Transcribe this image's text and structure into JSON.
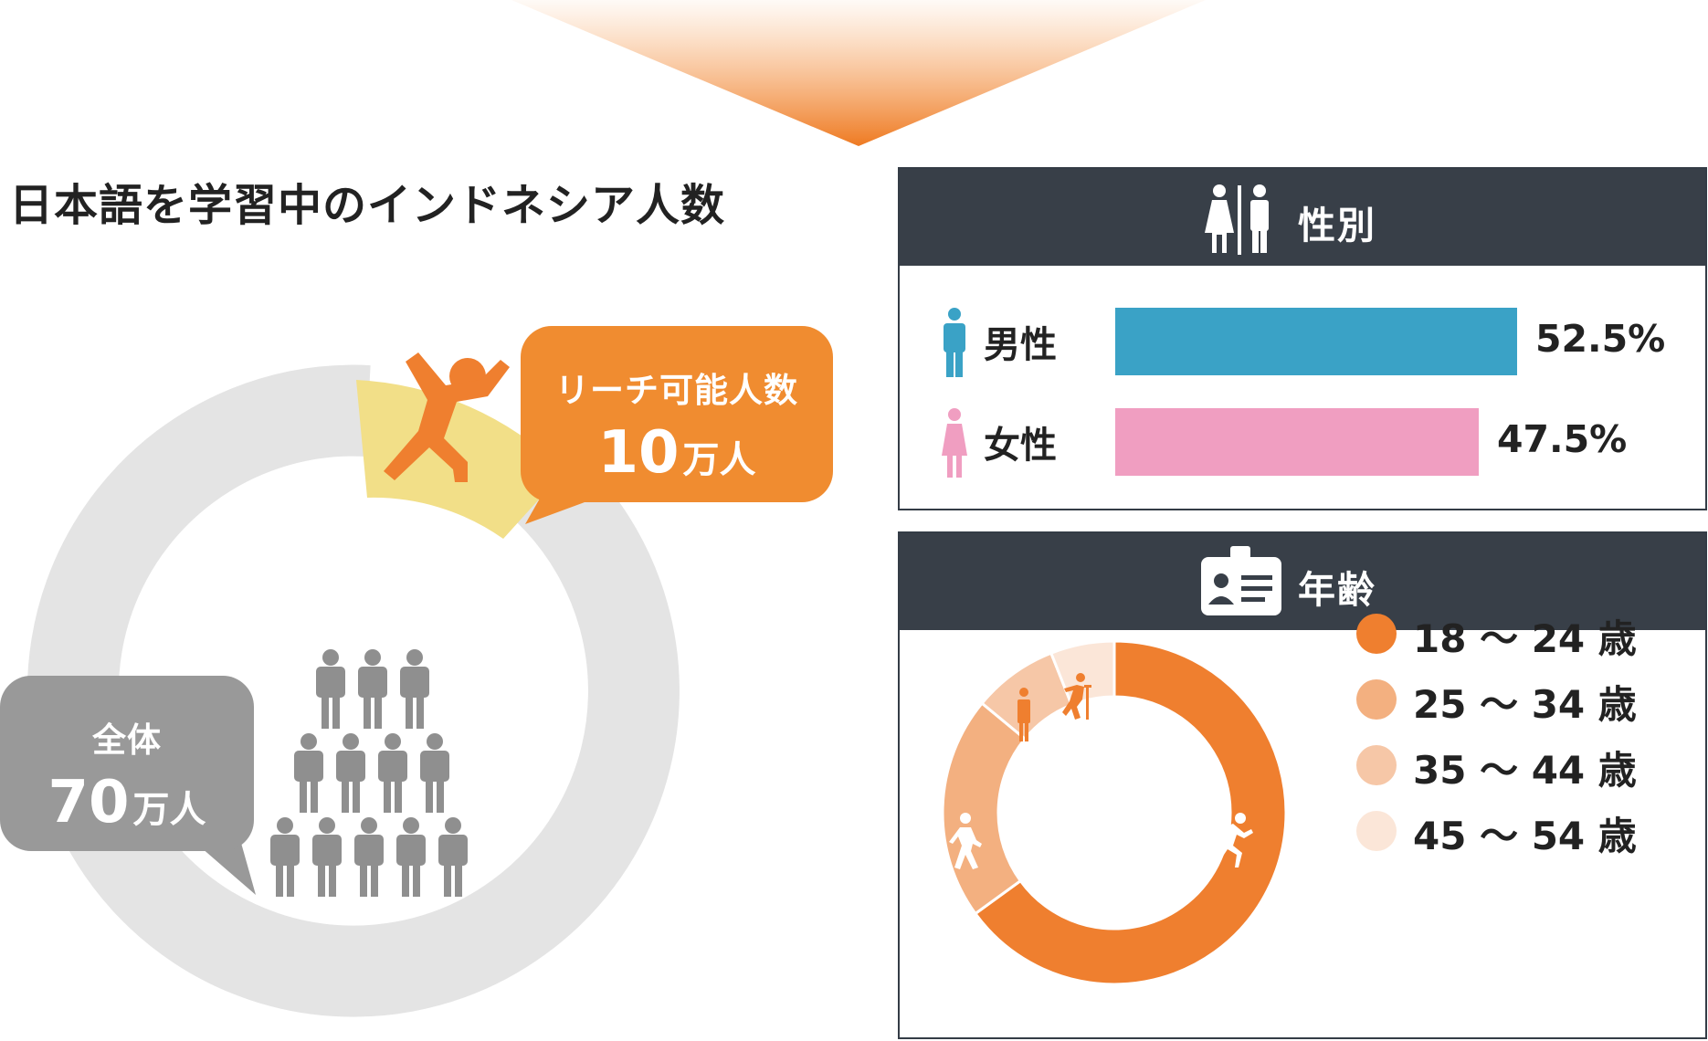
{
  "title": "日本語を学習中のインドネシア人数",
  "reach_bubble": {
    "label": "リーチ可能人数",
    "number": "10",
    "unit": "万人"
  },
  "total_bubble": {
    "label": "全体",
    "number": "70",
    "unit": "万人"
  },
  "colors": {
    "orange": "#ef7f2f",
    "reach_segment": "#f2df88",
    "ring_gray": "#e4e4e4",
    "people_gray": "#8f8f8f",
    "male_blue": "#3aa2c6",
    "female_pink": "#f09ec1",
    "header_dark": "#383f48"
  },
  "gender_panel": {
    "title": "性別",
    "header_icon": "male-female-icon",
    "rows": [
      {
        "label": "男性",
        "icon": "male-icon"
      },
      {
        "label": "女性",
        "icon": "female-icon"
      }
    ]
  },
  "age_panel": {
    "title": "年齢",
    "header_icon": "id-card-icon",
    "segment_icons": [
      "running-person-icon",
      "walking-person-icon",
      "standing-person-icon",
      "elderly-with-cane-icon"
    ]
  },
  "chart_data": [
    {
      "type": "pie",
      "title": "日本語を学習中のインドネシア人数",
      "categories": [
        "リーチ可能人数",
        "全体"
      ],
      "values": [
        10,
        70
      ],
      "unit": "万人"
    },
    {
      "type": "bar",
      "title": "性別",
      "categories": [
        "男性",
        "女性"
      ],
      "values": [
        52.5,
        47.5
      ],
      "labels": [
        "52.5%",
        "47.5%"
      ],
      "xlim": [
        0,
        52.5
      ]
    },
    {
      "type": "pie",
      "title": "年齢",
      "categories": [
        "18 〜 24 歳",
        "25 〜 34 歳",
        "35 〜 44 歳",
        "45 〜 54 歳"
      ],
      "values": [
        65,
        21,
        8,
        6
      ],
      "colors": [
        "#ef7f2f",
        "#f3b080",
        "#f6c7a7",
        "#fbe6d8"
      ],
      "legend": "right"
    }
  ]
}
